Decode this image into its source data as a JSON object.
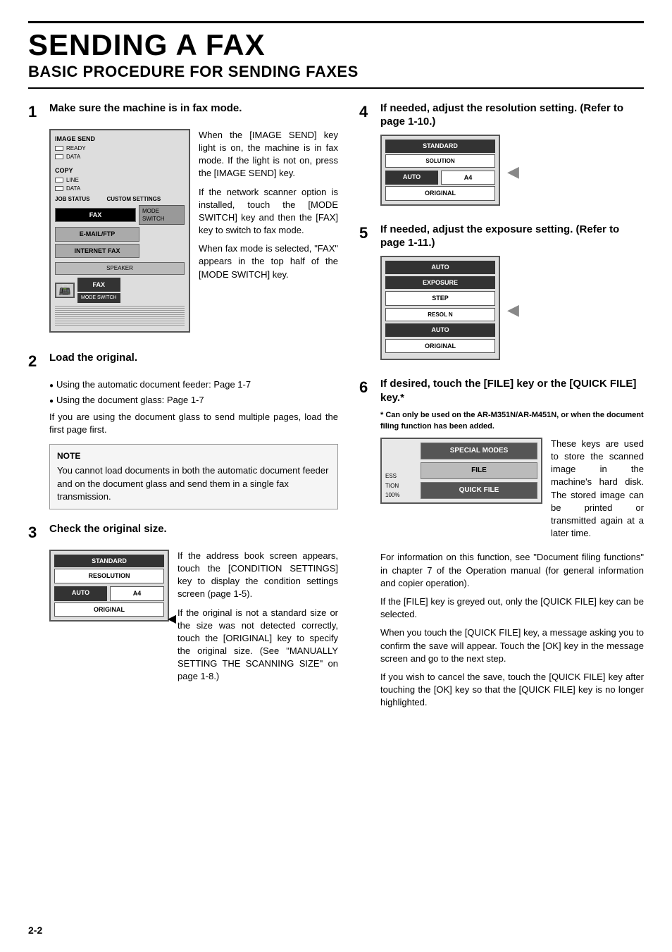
{
  "page": {
    "title": "SENDING A FAX",
    "subtitle": "BASIC PROCEDURE FOR SENDING FAXES",
    "footer": "2-2"
  },
  "steps": {
    "step1": {
      "num": "1",
      "title": "Make sure the machine is in fax mode.",
      "body1": "When the [IMAGE SEND] key light is on, the machine is in fax mode. If the light is not on, press the [IMAGE SEND] key.",
      "body2": "If the network scanner option is installed, touch the [MODE SWITCH] key and then the [FAX] key to switch to fax mode.",
      "body3": "When fax mode is selected, \"FAX\" appears in the top half of the [MODE SWITCH] key.",
      "panel_labels": {
        "image_send": "IMAGE SEND",
        "copy": "COPY",
        "job_status": "JOB STATUS",
        "custom_settings": "CUSTOM SETTINGS",
        "data": "DATA",
        "line": "LINE",
        "fax": "FAX",
        "email_ftp": "E-MAIL/FTP",
        "internet_fax": "INTERNET FAX",
        "mode_switch": "MODE SWITCH",
        "speaker": "SPEAKER",
        "fax_big": "FAX",
        "mode_switch_big": "MODE SWITCH",
        "ready": "READY"
      }
    },
    "step2": {
      "num": "2",
      "title": "Load the original.",
      "bullet1": "Using the automatic document feeder: Page 1-7",
      "bullet2": "Using the document glass: Page 1-7",
      "body": "If you are using the document glass to send multiple pages, load the first page first.",
      "note_title": "NOTE",
      "note_body": "You cannot load documents in both the automatic document feeder and on the document glass and send them in a single fax transmission."
    },
    "step3": {
      "num": "3",
      "title": "Check the original size.",
      "body1": "If the address book screen appears, touch the [CONDITION SETTINGS] key to display the condition settings screen (page 1-5).",
      "body2": "If the original is not a standard size or the size was not detected correctly, touch the [ORIGINAL] key to specify the original size. (See \"MANUALLY SETTING THE SCANNING SIZE\" on page 1-8.)",
      "panel": {
        "standard": "STANDARD",
        "resolution": "RESOLUTION",
        "auto": "AUTO",
        "a4": "A4",
        "original": "ORIGINAL"
      }
    },
    "step4": {
      "num": "4",
      "title": "If needed, adjust the resolution setting. (Refer to page 1-10.)",
      "panel": {
        "standard": "STANDARD",
        "solution": "SOLUTION",
        "auto": "AUTO",
        "a4": "A4",
        "original": "ORIGINAL"
      }
    },
    "step5": {
      "num": "5",
      "title": "If needed, adjust the exposure setting. (Refer to page 1-11.)",
      "panel": {
        "auto": "AUTO",
        "exposure": "EXPOSURE",
        "step": "STEP",
        "resolution_abbr": "RESOL    N",
        "auto2": "AUTO",
        "original": "ORIGINAL"
      }
    },
    "step6": {
      "num": "6",
      "title": "If desired, touch the [FILE] key or the [QUICK FILE] key.*",
      "subtitle_note": "* Can only be used on the AR-M351N/AR-M451N, or when the document filing function has been added.",
      "panel": {
        "special_modes": "SPECIAL MODES",
        "file": "FILE",
        "quick_file": "QUICK FILE",
        "ess": "ESS",
        "tion": "TION",
        "percent": "100%"
      },
      "body1": "These keys are used to store the scanned image in the machine's hard disk. The stored image can be printed or transmitted again at a later time.",
      "body2": "For information on this function, see \"Document filing functions\" in chapter 7 of the Operation manual (for general information and copier operation).",
      "body3": "If the [FILE] key is greyed out, only the [QUICK FILE] key can be selected.",
      "body4": "When you touch the [QUICK FILE] key, a message asking you to confirm the save will appear. Touch the [OK] key in the message screen and go to the next step.",
      "body5": "If you wish to cancel the save, touch the [QUICK FILE] key after touching the [OK] key so that the [QUICK FILE] key is no longer highlighted."
    }
  }
}
